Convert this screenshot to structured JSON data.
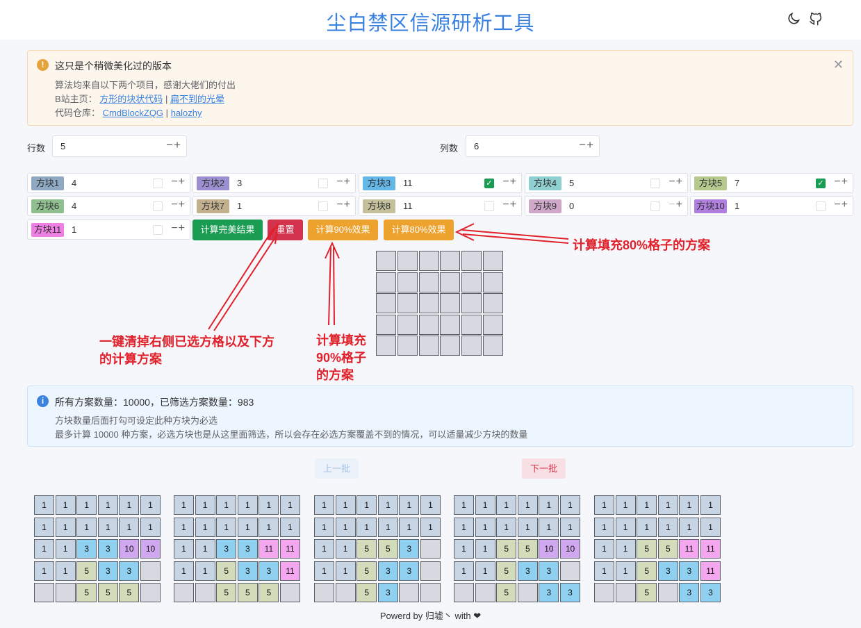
{
  "header": {
    "title": "尘白禁区信源研析工具",
    "theme_icon": "moon-icon",
    "github_icon": "github-icon"
  },
  "notice": {
    "title": "这只是个稍微美化过的版本",
    "desc": "算法均来自以下两个项目，感谢大佬们的付出",
    "bili_label": "B站主页：",
    "bili_links": [
      "方形的块状代码",
      "扁不到的光晕"
    ],
    "repo_label": "代码仓库：",
    "repo_links": [
      "CmdBlockZQG",
      "halozhy"
    ],
    "separator": "|"
  },
  "dims": {
    "rows_label": "行数",
    "rows_value": "5",
    "cols_label": "列数",
    "cols_value": "6"
  },
  "blocks": [
    {
      "label": "方块1",
      "count": "4",
      "checked": false,
      "color": "#8fa9c3"
    },
    {
      "label": "方块2",
      "count": "3",
      "checked": false,
      "color": "#9b8fcf"
    },
    {
      "label": "方块3",
      "count": "11",
      "checked": true,
      "color": "#63b8e8"
    },
    {
      "label": "方块4",
      "count": "5",
      "checked": false,
      "color": "#8fcfcf"
    },
    {
      "label": "方块5",
      "count": "7",
      "checked": true,
      "color": "#b5c98f"
    },
    {
      "label": "方块6",
      "count": "4",
      "checked": false,
      "color": "#8fbf8f"
    },
    {
      "label": "方块7",
      "count": "1",
      "checked": false,
      "color": "#c3b08f"
    },
    {
      "label": "方块8",
      "count": "11",
      "checked": false,
      "color": "#c3c09b"
    },
    {
      "label": "方块9",
      "count": "0",
      "checked": false,
      "color": "#cfa8c9"
    },
    {
      "label": "方块10",
      "count": "1",
      "checked": false,
      "color": "#b07fe0"
    },
    {
      "label": "方块11",
      "count": "1",
      "checked": false,
      "color": "#ef7fe3"
    }
  ],
  "actions": {
    "perfect": "计算完美结果",
    "reset": "重置",
    "fill90": "计算90%效果",
    "fill80": "计算80%效果"
  },
  "annotations": {
    "reset_note": [
      "一键清掉右侧已选方格以及下方",
      "的计算方案"
    ],
    "fill90_note": [
      "计算填充",
      "90%格子",
      "的方案"
    ],
    "fill80_note": "计算填充80%格子的方案"
  },
  "info": {
    "title": "所有方案数量：10000，已筛选方案数量：983",
    "line1": "方块数量后面打勾可设定此种方块为必选",
    "line2": "最多计算 10000 种方案，必选方块也是从这里面筛选，所以会存在必选方案覆盖不到的情况，可以适量减少方块的数量"
  },
  "pager": {
    "prev": "上一批",
    "next": "下一批"
  },
  "results": [
    [
      [
        "1",
        "1",
        "1",
        "1",
        "1",
        "1"
      ],
      [
        "1",
        "1",
        "1",
        "1",
        "1",
        "1"
      ],
      [
        "1",
        "1",
        "3",
        "3",
        "10",
        "10"
      ],
      [
        "1",
        "1",
        "5",
        "3",
        "3",
        ""
      ],
      [
        "",
        "",
        "5",
        "5",
        "5",
        ""
      ]
    ],
    [
      [
        "1",
        "1",
        "1",
        "1",
        "1",
        "1"
      ],
      [
        "1",
        "1",
        "1",
        "1",
        "1",
        "1"
      ],
      [
        "1",
        "1",
        "3",
        "3",
        "11",
        "11"
      ],
      [
        "1",
        "1",
        "5",
        "3",
        "3",
        "11"
      ],
      [
        "",
        "",
        "5",
        "5",
        "5",
        ""
      ]
    ],
    [
      [
        "1",
        "1",
        "1",
        "1",
        "1",
        "1"
      ],
      [
        "1",
        "1",
        "1",
        "1",
        "1",
        "1"
      ],
      [
        "1",
        "1",
        "5",
        "5",
        "3",
        ""
      ],
      [
        "1",
        "1",
        "5",
        "3",
        "3",
        ""
      ],
      [
        "",
        "",
        "5",
        "3",
        "",
        ""
      ]
    ],
    [
      [
        "1",
        "1",
        "1",
        "1",
        "1",
        "1"
      ],
      [
        "1",
        "1",
        "1",
        "1",
        "1",
        "1"
      ],
      [
        "1",
        "1",
        "5",
        "5",
        "10",
        "10"
      ],
      [
        "1",
        "1",
        "5",
        "3",
        "3",
        ""
      ],
      [
        "",
        "",
        "5",
        "",
        "3",
        "3"
      ]
    ],
    [
      [
        "1",
        "1",
        "1",
        "1",
        "1",
        "1"
      ],
      [
        "1",
        "1",
        "1",
        "1",
        "1",
        "1"
      ],
      [
        "1",
        "1",
        "5",
        "5",
        "11",
        "11"
      ],
      [
        "1",
        "1",
        "5",
        "3",
        "3",
        "11"
      ],
      [
        "",
        "",
        "5",
        "",
        "3",
        "3"
      ]
    ]
  ],
  "cell_colors": {
    "1": "#c7d4e3",
    "3": "#8fd0f0",
    "5": "#d3dcba",
    "10": "#cfa8ef",
    "11": "#f4a7ee",
    "empty": "#d6d9df"
  },
  "footer": "Powerd by 归墟丶 with ❤"
}
